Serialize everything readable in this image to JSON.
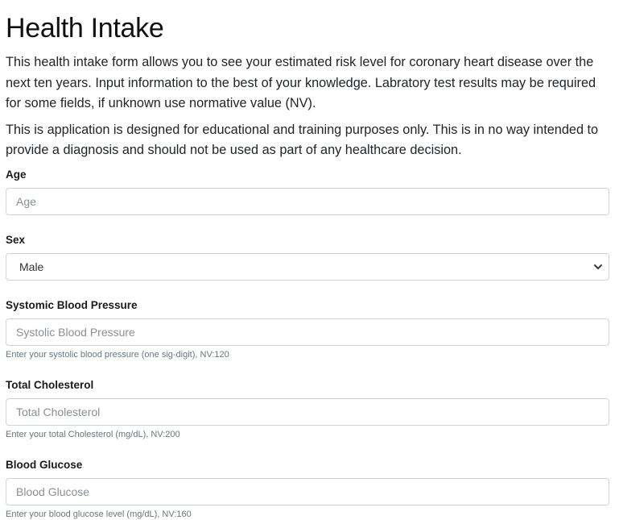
{
  "title": "Health Intake",
  "intro": {
    "paragraph1": "This health intake form allows you to see your estimated risk level for coronary heart disease over the next ten years. Input information to the best of your knowledge. Labratory test results may be required for some fields, if unknown use normative value (NV).",
    "paragraph2": "This is application is designed for educational and training purposes only. This is in no way intended to provide a diagnosis and should not be used as part of any healthcare decision."
  },
  "form": {
    "age": {
      "label": "Age",
      "placeholder": "Age",
      "value": ""
    },
    "sex": {
      "label": "Sex",
      "selected": "Male",
      "icon": "chevron-down-icon"
    },
    "systolic": {
      "label": "Systomic Blood Pressure",
      "placeholder": "Systolic Blood Pressure",
      "value": "",
      "help": "Enter your systolic blood pressure (one sig-digit), NV:120"
    },
    "cholesterol": {
      "label": "Total Cholesterol",
      "placeholder": "Total Cholesterol",
      "value": "",
      "help": "Enter your total Cholesterol (mg/dL), NV:200"
    },
    "glucose": {
      "label": "Blood Glucose",
      "placeholder": "Blood Glucose",
      "value": "",
      "help": "Enter your blood glucose level (mg/dL), NV:160"
    }
  }
}
